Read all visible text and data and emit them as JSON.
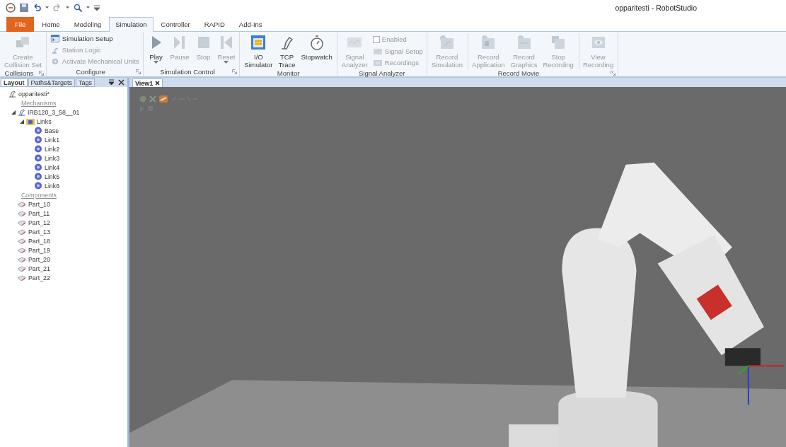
{
  "window": {
    "title": "opparitesti - RobotStudio"
  },
  "ribbon": {
    "tabs": [
      {
        "label": "File",
        "kind": "file",
        "selected": false
      },
      {
        "label": "Home",
        "kind": "tab",
        "selected": false
      },
      {
        "label": "Modeling",
        "kind": "tab",
        "selected": false
      },
      {
        "label": "Simulation",
        "kind": "tab",
        "selected": true
      },
      {
        "label": "Controller",
        "kind": "tab",
        "selected": false
      },
      {
        "label": "RAPID",
        "kind": "tab",
        "selected": false
      },
      {
        "label": "Add-Ins",
        "kind": "tab",
        "selected": false
      }
    ],
    "groups": [
      {
        "label": "Collisions",
        "launcher": true,
        "items": [
          {
            "kind": "large",
            "lines": [
              "Create",
              "Collision Set"
            ],
            "disabled": true
          }
        ]
      },
      {
        "label": "Configure",
        "launcher": true,
        "items": [
          {
            "kind": "small",
            "label": "Simulation Setup",
            "disabled": false
          },
          {
            "kind": "small",
            "label": "Station Logic",
            "disabled": true
          },
          {
            "kind": "small",
            "label": "Activate Mechanical Units",
            "disabled": true
          }
        ]
      },
      {
        "label": "Simulation Control",
        "launcher": true,
        "items": [
          {
            "kind": "large",
            "lines": [
              "Play"
            ],
            "dropdown": true,
            "disabled": false
          },
          {
            "kind": "large",
            "lines": [
              "Pause"
            ],
            "disabled": true
          },
          {
            "kind": "large",
            "lines": [
              "Stop"
            ],
            "disabled": true
          },
          {
            "kind": "large",
            "lines": [
              "Reset"
            ],
            "dropdown": true,
            "disabled": true
          }
        ]
      },
      {
        "label": "Monitor",
        "launcher": false,
        "items": [
          {
            "kind": "large",
            "lines": [
              "I/O",
              "Simulator"
            ],
            "disabled": false
          },
          {
            "kind": "large",
            "lines": [
              "TCP",
              "Trace"
            ],
            "disabled": false
          },
          {
            "kind": "large",
            "lines": [
              "Stopwatch"
            ],
            "disabled": false
          }
        ]
      },
      {
        "label": "Signal Analyzer",
        "launcher": false,
        "items": [
          {
            "kind": "large",
            "lines": [
              "Signal",
              "Analyzer"
            ],
            "disabled": true
          },
          {
            "kind": "checkbox",
            "label": "Enabled",
            "checked": false,
            "disabled": true
          },
          {
            "kind": "small",
            "label": "Signal Setup",
            "disabled": true
          },
          {
            "kind": "small",
            "label": "Recordings",
            "disabled": true
          }
        ]
      },
      {
        "label": "Record Movie",
        "launcher": true,
        "items": [
          {
            "kind": "large",
            "lines": [
              "Record",
              "Simulation"
            ],
            "disabled": true
          },
          {
            "kind": "large",
            "lines": [
              "Record",
              "Application"
            ],
            "divider": true,
            "disabled": true
          },
          {
            "kind": "large",
            "lines": [
              "Record",
              "Graphics"
            ],
            "disabled": true
          },
          {
            "kind": "large",
            "lines": [
              "Stop",
              "Recording"
            ],
            "disabled": true
          },
          {
            "kind": "large",
            "lines": [
              "View",
              "Recording"
            ],
            "divider": true,
            "disabled": true
          }
        ]
      }
    ]
  },
  "layout_panel": {
    "tabs": [
      {
        "label": "Layout",
        "selected": true
      },
      {
        "label": "Paths&Targets",
        "selected": false
      },
      {
        "label": "Tags",
        "selected": false
      }
    ],
    "tree": {
      "label": "opparitesti*",
      "kind": "station",
      "children": [
        {
          "label": "Mechanisms",
          "kind": "header"
        },
        {
          "label": "IRB120_3_58__01",
          "kind": "robot",
          "expanded": true,
          "children": [
            {
              "label": "Links",
              "kind": "folder",
              "expanded": true,
              "children": [
                {
                  "label": "Base",
                  "kind": "link"
                },
                {
                  "label": "Link1",
                  "kind": "link"
                },
                {
                  "label": "Link2",
                  "kind": "link"
                },
                {
                  "label": "Link3",
                  "kind": "link"
                },
                {
                  "label": "Link4",
                  "kind": "link"
                },
                {
                  "label": "Link5",
                  "kind": "link"
                },
                {
                  "label": "Link6",
                  "kind": "link"
                }
              ]
            }
          ]
        },
        {
          "label": "Components",
          "kind": "header"
        },
        {
          "label": "Part_10",
          "kind": "part"
        },
        {
          "label": "Part_11",
          "kind": "part"
        },
        {
          "label": "Part_12",
          "kind": "part"
        },
        {
          "label": "Part_13",
          "kind": "part"
        },
        {
          "label": "Part_18",
          "kind": "part"
        },
        {
          "label": "Part_19",
          "kind": "part"
        },
        {
          "label": "Part_20",
          "kind": "part"
        },
        {
          "label": "Part_21",
          "kind": "part"
        },
        {
          "label": "Part_22",
          "kind": "part"
        }
      ]
    }
  },
  "documents": {
    "tabs": [
      {
        "label": "View1",
        "selected": true
      }
    ]
  }
}
